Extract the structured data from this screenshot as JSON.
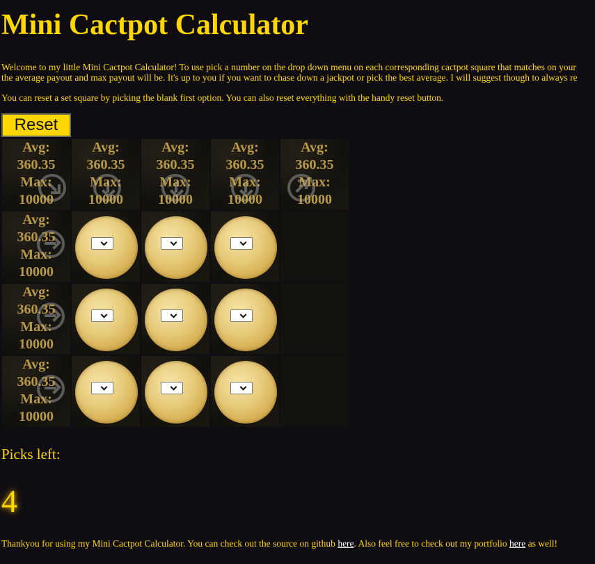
{
  "title": "Mini Cactpot Calculator",
  "intro": {
    "line1": "Welcome to my little Mini Cactpot Calculator! To use pick a number on the drop down menu on each corresponding cactpot square that matches on your",
    "line2": "the average payout and max payout will be. It's up to you if you want to chase down a jackpot or pick the best average. I will suggest though to always re"
  },
  "reset_note": "You can reset a set square by picking the blank first option. You can also reset everything with the handy reset button.",
  "reset_button": "Reset",
  "line_stats": {
    "avg_label": "Avg:",
    "avg_value": "360.35",
    "max_label": "Max:",
    "max_value": "10000"
  },
  "picks_left_label": "Picks left:",
  "picks_left_value": "4",
  "footer": {
    "text1": "Thankyou for using my Mini Cactpot Calculator. You can check out the source on github ",
    "link1": "here",
    "text2": ". Also feel free to check out my portfolio ",
    "link2": "here",
    "text3": " as well!"
  },
  "colors": {
    "background": "#100d12",
    "accent": "#ffd700",
    "stats": "#c8a84e",
    "link": "#ffffff"
  },
  "icons": {
    "line_arrow": "arrow-circle-icon",
    "dropdown_chevron": "chevron-down-icon",
    "cactpot_square": "coin-icon"
  }
}
